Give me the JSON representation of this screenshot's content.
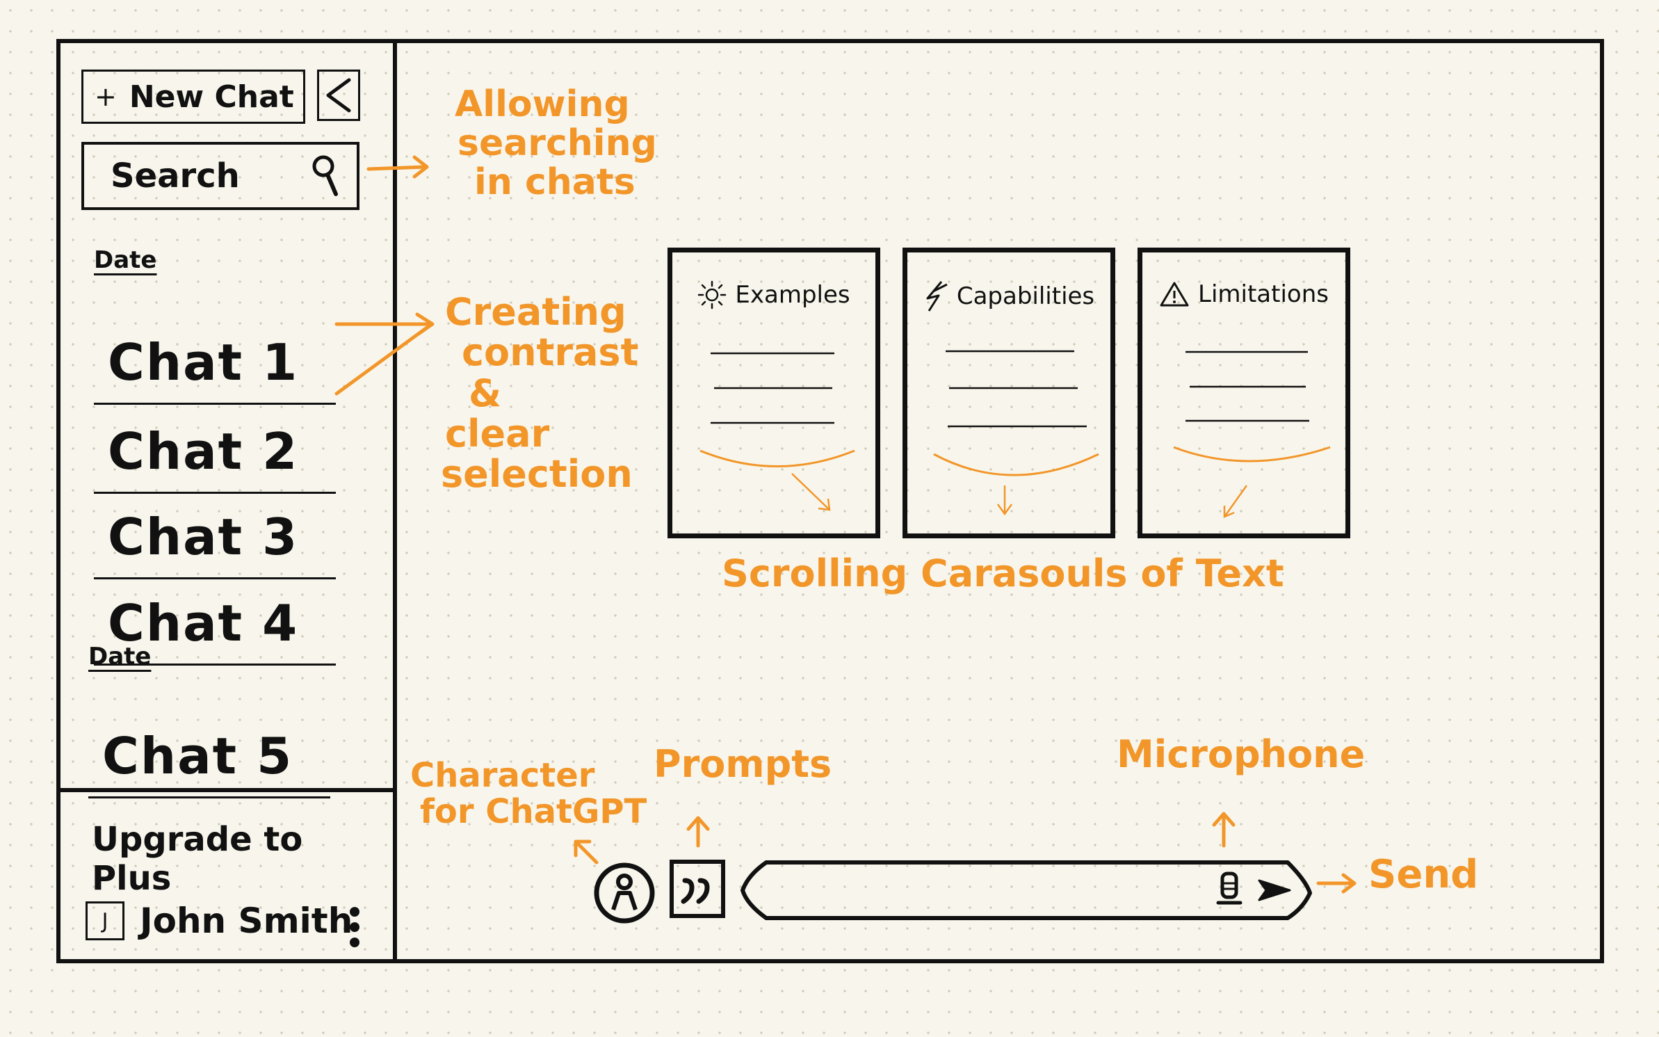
{
  "sidebar": {
    "new_chat_label": "New Chat",
    "new_chat_icon": "plus-icon",
    "collapse_icon": "chevron-left-icon",
    "search_label": "Search",
    "search_icon": "search-icon",
    "groups": [
      {
        "date_label": "Date",
        "chats": [
          "Chat 1",
          "Chat 2",
          "Chat 3",
          "Chat 4"
        ]
      },
      {
        "date_label": "Date",
        "chats": [
          "Chat 5"
        ]
      }
    ],
    "upgrade_label": "Upgrade to Plus",
    "user": {
      "avatar_initial": "J",
      "name": "John Smith",
      "menu_icon": "kebab-menu-icon"
    }
  },
  "cards": [
    {
      "icon": "sun-icon",
      "title": "Examples"
    },
    {
      "icon": "lightning-icon",
      "title": "Capabilities"
    },
    {
      "icon": "warning-icon",
      "title": "Limitations"
    }
  ],
  "input_bar": {
    "character_icon": "character-icon",
    "prompts_icon": "quote-icon",
    "microphone_icon": "microphone-icon",
    "send_icon": "send-icon"
  },
  "annotations": {
    "search_note": [
      "Allowing",
      "searching",
      "in chats"
    ],
    "contrast_note": [
      "Creating",
      "contrast",
      "&",
      "clear",
      "selection"
    ],
    "carousel_note": "Scrolling Carasouls of Text",
    "character_note": [
      "Character",
      "for ChatGPT"
    ],
    "prompts_note": "Prompts",
    "microphone_note": "Microphone",
    "send_note": "Send"
  },
  "colors": {
    "ink": "#111111",
    "annotation": "#f2962a",
    "paper": "#f8f6ec"
  }
}
